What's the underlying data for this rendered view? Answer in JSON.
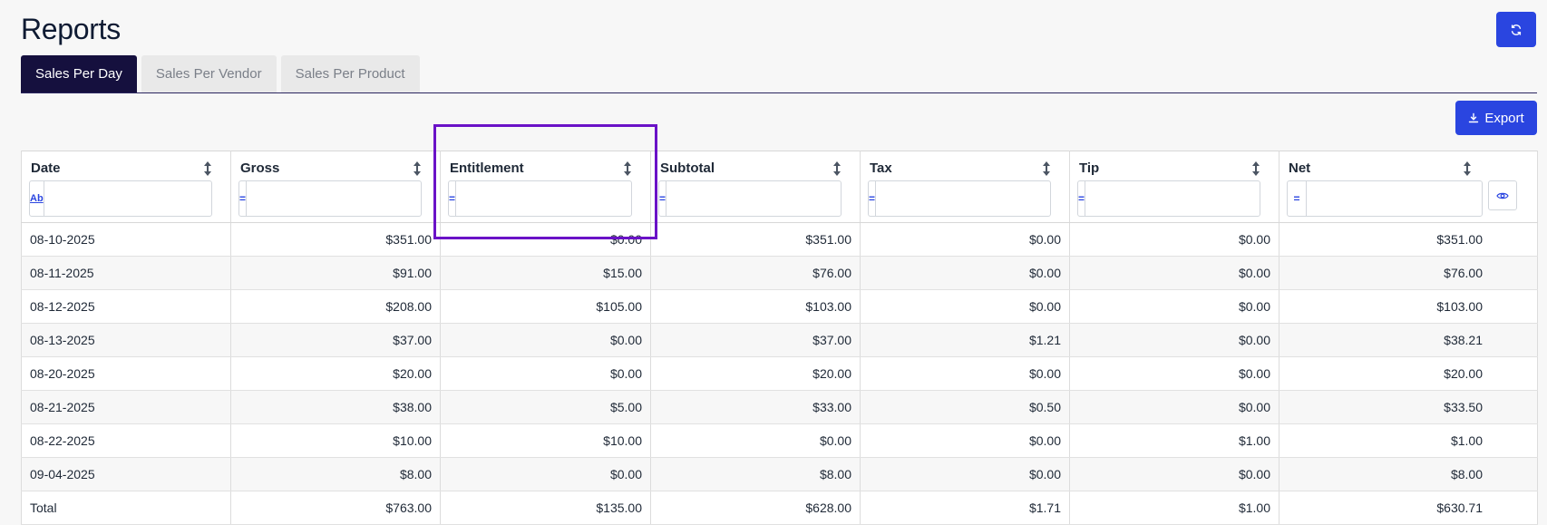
{
  "page": {
    "title": "Reports"
  },
  "tabs": [
    {
      "label": "Sales Per Day",
      "active": true
    },
    {
      "label": "Sales Per Vendor",
      "active": false
    },
    {
      "label": "Sales Per Product",
      "active": false
    }
  ],
  "toolbar": {
    "export_label": "Export",
    "refresh_icon": "refresh-icon",
    "export_icon": "download-icon"
  },
  "table": {
    "columns": [
      {
        "label": "Date",
        "filter_mode": "Ab",
        "filter_value": ""
      },
      {
        "label": "Gross",
        "filter_mode": "=",
        "filter_value": ""
      },
      {
        "label": "Entitlement",
        "filter_mode": "=",
        "filter_value": ""
      },
      {
        "label": "Subtotal",
        "filter_mode": "=",
        "filter_value": ""
      },
      {
        "label": "Tax",
        "filter_mode": "=",
        "filter_value": ""
      },
      {
        "label": "Tip",
        "filter_mode": "=",
        "filter_value": ""
      },
      {
        "label": "Net",
        "filter_mode": "=",
        "filter_value": ""
      }
    ],
    "rows": [
      [
        "08-10-2025",
        "$351.00",
        "$0.00",
        "$351.00",
        "$0.00",
        "$0.00",
        "$351.00"
      ],
      [
        "08-11-2025",
        "$91.00",
        "$15.00",
        "$76.00",
        "$0.00",
        "$0.00",
        "$76.00"
      ],
      [
        "08-12-2025",
        "$208.00",
        "$105.00",
        "$103.00",
        "$0.00",
        "$0.00",
        "$103.00"
      ],
      [
        "08-13-2025",
        "$37.00",
        "$0.00",
        "$37.00",
        "$1.21",
        "$0.00",
        "$38.21"
      ],
      [
        "08-20-2025",
        "$20.00",
        "$0.00",
        "$20.00",
        "$0.00",
        "$0.00",
        "$20.00"
      ],
      [
        "08-21-2025",
        "$38.00",
        "$5.00",
        "$33.00",
        "$0.50",
        "$0.00",
        "$33.50"
      ],
      [
        "08-22-2025",
        "$10.00",
        "$10.00",
        "$0.00",
        "$0.00",
        "$1.00",
        "$1.00"
      ],
      [
        "09-04-2025",
        "$8.00",
        "$0.00",
        "$8.00",
        "$0.00",
        "$0.00",
        "$8.00"
      ]
    ],
    "totals": [
      "Total",
      "$763.00",
      "$135.00",
      "$628.00",
      "$1.71",
      "$1.00",
      "$630.71"
    ]
  },
  "colors": {
    "accent": "#2a45e0",
    "active_tab": "#15103e",
    "highlight": "#6a12c7"
  }
}
